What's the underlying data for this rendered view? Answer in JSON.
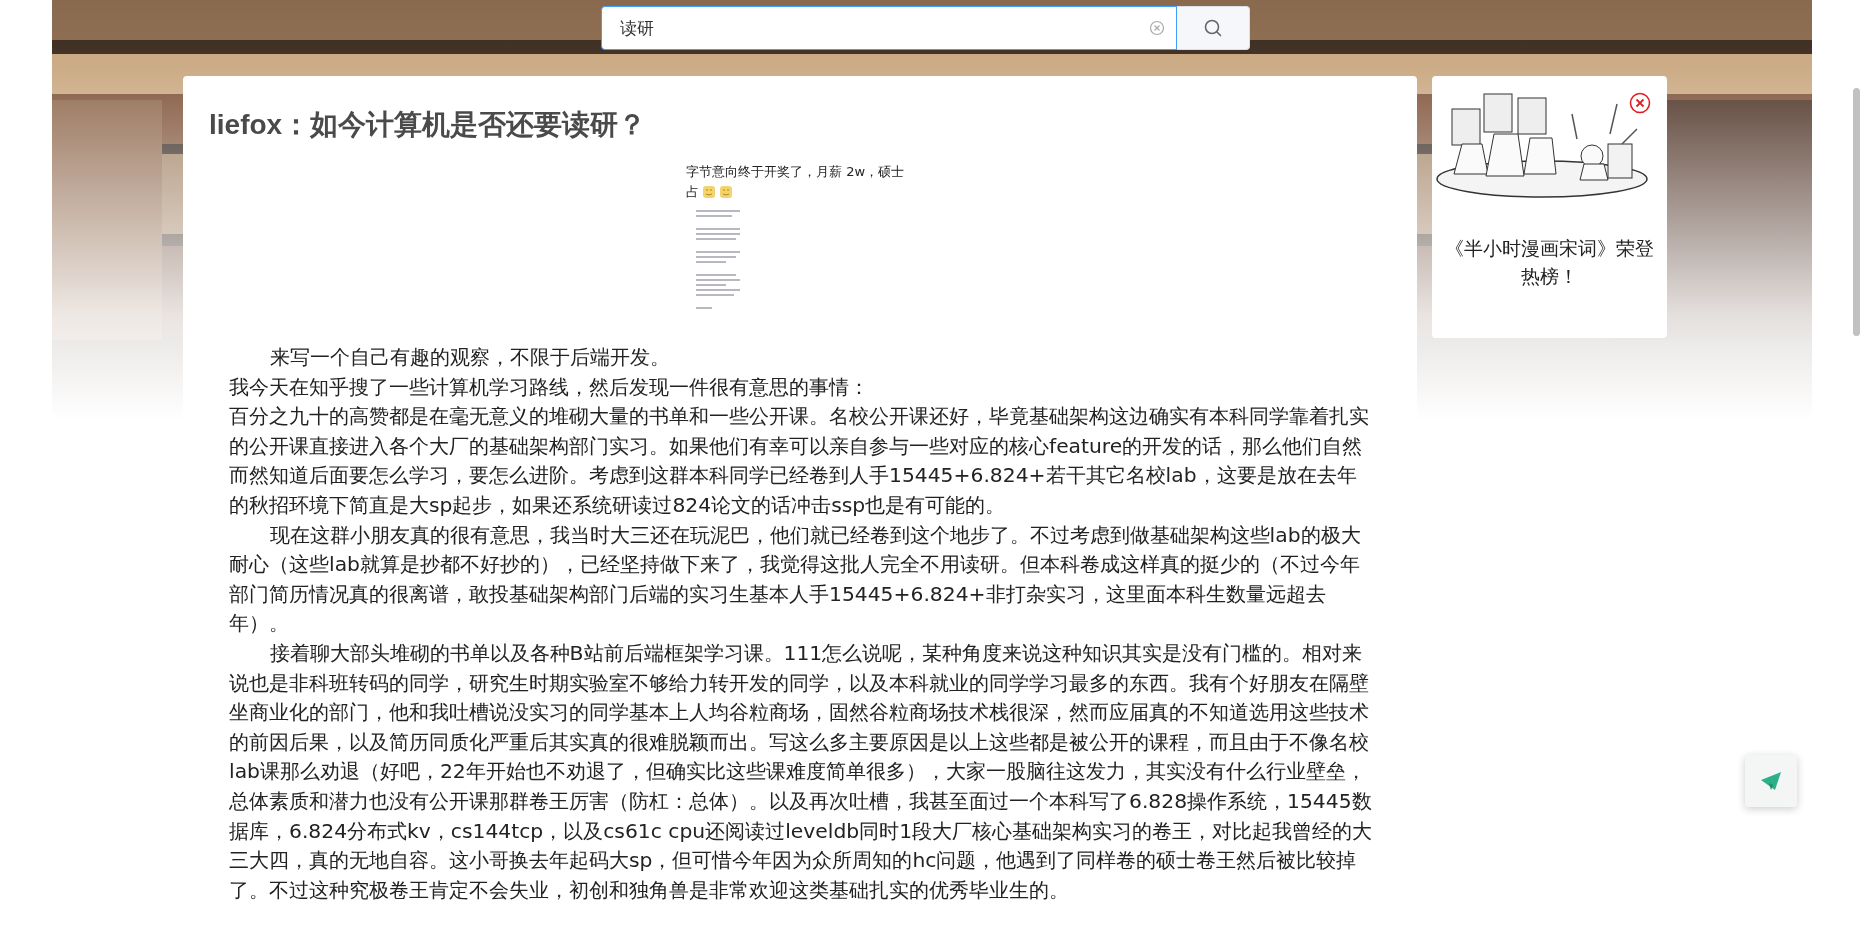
{
  "search": {
    "value": "读研",
    "focused": true
  },
  "article": {
    "title": "liefox：如今计算机是否还要读研？",
    "image": {
      "caption_lines": [
        "字节意向终于开奖了，月薪 2w，硕士",
        "占"
      ]
    },
    "paragraphs": [
      {
        "indent": true,
        "text": "来写一个自己有趣的观察，不限于后端开发。"
      },
      {
        "indent": false,
        "text": "我今天在知乎搜了一些计算机学习路线，然后发现一件很有意思的事情："
      },
      {
        "indent": false,
        "text": "百分之九十的高赞都是在毫无意义的堆砌大量的书单和一些公开课。名校公开课还好，毕竟基础架构这边确实有本科同学靠着扎实的公开课直接进入各个大厂的基础架构部门实习。如果他们有幸可以亲自参与一些对应的核心feature的开发的话，那么他们自然而然知道后面要怎么学习，要怎么进阶。考虑到这群本科同学已经卷到人手15445+6.824+若干其它名校lab，这要是放在去年的秋招环境下简直是大sp起步，如果还系统研读过824论文的话冲击ssp也是有可能的。"
      },
      {
        "indent": true,
        "text": "现在这群小朋友真的很有意思，我当时大三还在玩泥巴，他们就已经卷到这个地步了。不过考虑到做基础架构这些lab的极大耐心（这些lab就算是抄都不好抄的），已经坚持做下来了，我觉得这批人完全不用读研。但本科卷成这样真的挺少的（不过今年部门简历情况真的很离谱，敢投基础架构部门后端的实习生基本人手15445+6.824+非打杂实习，这里面本科生数量远超去年）。"
      },
      {
        "indent": true,
        "text": "接着聊大部头堆砌的书单以及各种B站前后端框架学习课。111怎么说呢，某种角度来说这种知识其实是没有门槛的。相对来说也是非科班转码的同学，研究生时期实验室不够给力转开发的同学，以及本科就业的同学学习最多的东西。我有个好朋友在隔壁坐商业化的部门，他和我吐槽说没实习的同学基本上人均谷粒商场，固然谷粒商场技术栈很深，然而应届真的不知道选用这些技术的前因后果，以及简历同质化严重后其实真的很难脱颖而出。写这么多主要原因是以上这些都是被公开的课程，而且由于不像名校lab课那么劝退（好吧，22年开始也不劝退了，但确实比这些课难度简单很多），大家一股脑往这发力，其实没有什么行业壁垒，总体素质和潜力也没有公开课那群卷王厉害（防杠：总体）。以及再次吐槽，我甚至面过一个本科写了6.828操作系统，15445数据库，6.824分布式kv，cs144tcp，以及cs61c cpu还阅读过leveldb同时1段大厂核心基础架构实习的卷王，对比起我曾经的大三大四，真的无地自容。这小哥换去年起码大sp，但可惜今年因为众所周知的hc问题，他遇到了同样卷的硕士卷王然后被比较掉了。不过这种究极卷王肯定不会失业，初创和独角兽是非常欢迎这类基础扎实的优秀毕业生的。"
      }
    ]
  },
  "promo": {
    "text": "《半小时漫画宋词》荣登热榜！"
  }
}
